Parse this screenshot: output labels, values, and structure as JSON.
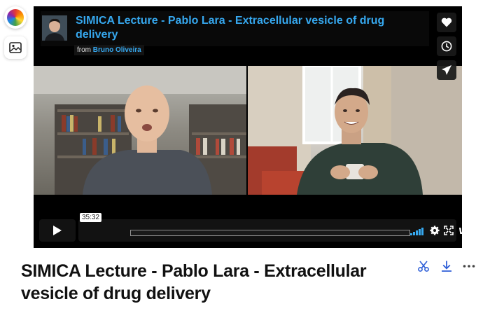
{
  "player": {
    "title": "SIMICA Lecture - Pablo Lara - Extracellular vesicle of drug delivery",
    "byline_prefix": "from",
    "owner": "Bruno Oliveira",
    "timecode": "35:32",
    "brand": "vimeo",
    "side_actions": [
      "like-icon",
      "watch-later-icon",
      "share-icon"
    ],
    "controls": [
      "play-icon",
      "volume-icon",
      "settings-icon",
      "fullscreen-icon"
    ]
  },
  "rail": {
    "icons": [
      "color-wheel-icon",
      "image-icon"
    ]
  },
  "page": {
    "title": "SIMICA Lecture - Pablo Lara - Extracellular vesicle of drug delivery",
    "actions": [
      "clip-icon",
      "download-icon",
      "more-icon"
    ]
  },
  "colors": {
    "accent": "#36a8ef",
    "player_bg": "#000000",
    "text": "#111111"
  }
}
